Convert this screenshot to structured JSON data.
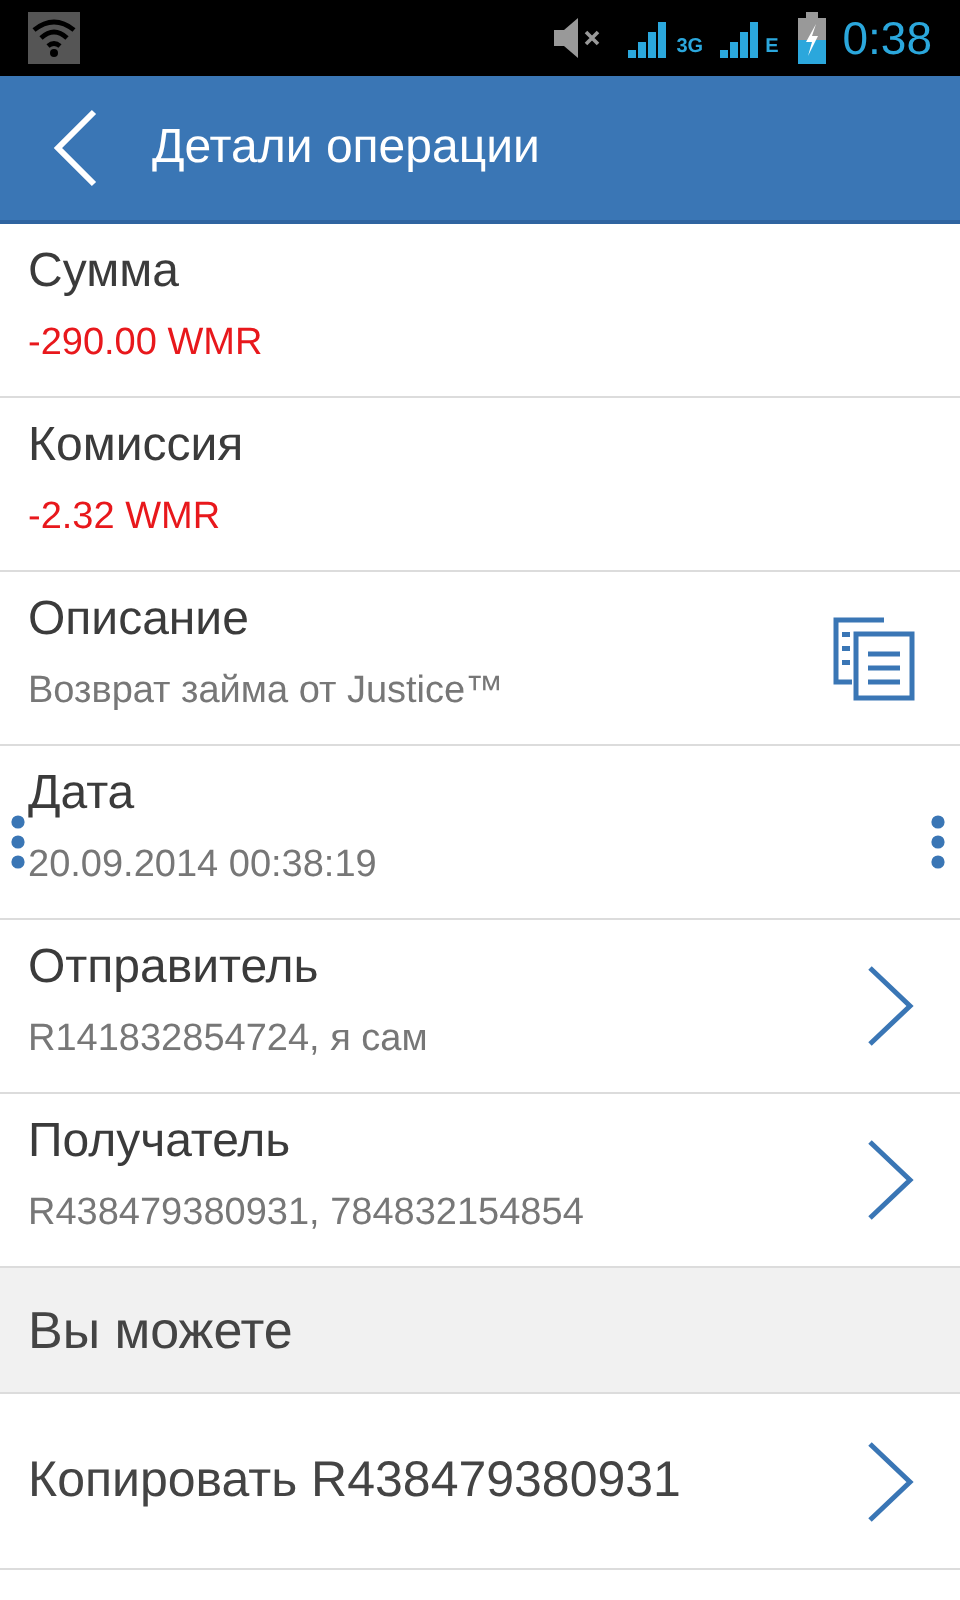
{
  "status_bar": {
    "network_1": "3G",
    "network_2": "E",
    "time": "0:38"
  },
  "app_bar": {
    "title": "Детали операции"
  },
  "rows": [
    {
      "label": "Сумма",
      "value": "-290.00 WMR",
      "negative": true,
      "text_selected": false,
      "kind": "plain"
    },
    {
      "label": "Комиссия",
      "value": "-2.32 WMR",
      "negative": true,
      "text_selected": false,
      "kind": "plain"
    },
    {
      "label": "Описание",
      "value": "Возврат займа от Justice™",
      "negative": false,
      "text_selected": false,
      "kind": "copy"
    },
    {
      "label": "Дата",
      "value": "20.09.2014 00:38:19",
      "negative": false,
      "text_selected": true,
      "kind": "plain"
    },
    {
      "label": "Отправитель",
      "value": "R141832854724, я сам",
      "negative": false,
      "text_selected": false,
      "kind": "link"
    },
    {
      "label": "Получатель",
      "value": "R438479380931, 784832154854",
      "negative": false,
      "text_selected": false,
      "kind": "link"
    }
  ],
  "section": {
    "title": "Вы можете"
  },
  "actions": [
    {
      "label": "Копировать R438479380931"
    }
  ]
}
